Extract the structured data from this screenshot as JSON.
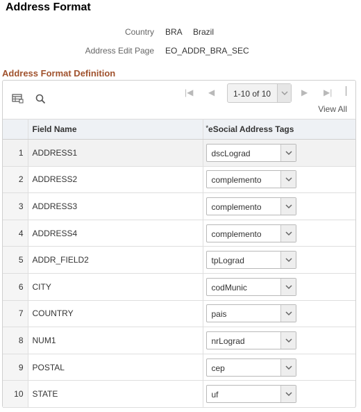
{
  "page": {
    "title": "Address Format"
  },
  "info": {
    "country_label": "Country",
    "country_code": "BRA",
    "country_name": "Brazil",
    "edit_page_label": "Address Edit Page",
    "edit_page_value": "EO_ADDR_BRA_SEC"
  },
  "section": {
    "title": "Address Format Definition"
  },
  "grid": {
    "pager_text": "1-10 of 10",
    "view_all": "View All",
    "headers": {
      "num": "",
      "field": "Field Name",
      "tag": "eSocial Address Tags",
      "required_mark": "*"
    },
    "rows": [
      {
        "num": "1",
        "field": "ADDRESS1",
        "tag": "dscLograd"
      },
      {
        "num": "2",
        "field": "ADDRESS2",
        "tag": "complemento"
      },
      {
        "num": "3",
        "field": "ADDRESS3",
        "tag": "complemento"
      },
      {
        "num": "4",
        "field": "ADDRESS4",
        "tag": "complemento"
      },
      {
        "num": "5",
        "field": "ADDR_FIELD2",
        "tag": "tpLograd"
      },
      {
        "num": "6",
        "field": "CITY",
        "tag": "codMunic"
      },
      {
        "num": "7",
        "field": "COUNTRY",
        "tag": "pais"
      },
      {
        "num": "8",
        "field": "NUM1",
        "tag": "nrLograd"
      },
      {
        "num": "9",
        "field": "POSTAL",
        "tag": "cep"
      },
      {
        "num": "10",
        "field": "STATE",
        "tag": "uf"
      }
    ]
  },
  "icons": {
    "personalize": "grid-personalize-icon",
    "find": "search-icon",
    "first": "first-page-icon",
    "prev": "previous-page-icon",
    "next": "next-page-icon",
    "last": "last-page-icon"
  },
  "colors": {
    "section_title": "#a0522d",
    "header_bg": "#eef1f5"
  }
}
